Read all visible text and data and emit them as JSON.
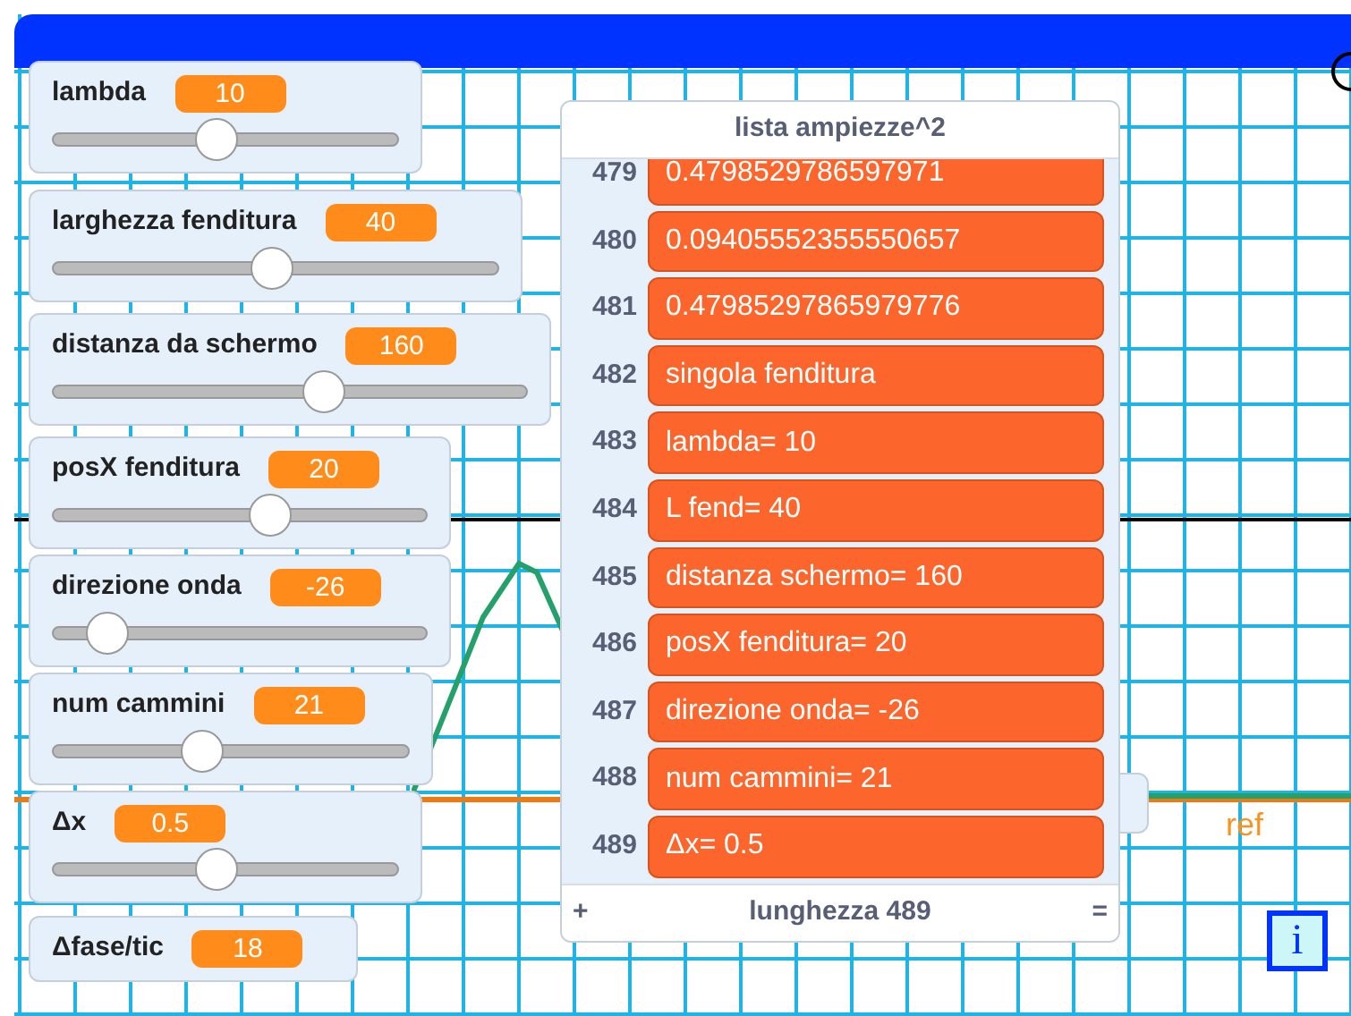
{
  "monitors": [
    {
      "label": "lambda",
      "value": "10",
      "level": 0.47,
      "kind": "slider"
    },
    {
      "label": "larghezza fenditura",
      "value": "40",
      "level": 0.49,
      "kind": "slider"
    },
    {
      "label": "distanza da schermo",
      "value": "160",
      "level": 0.58,
      "kind": "slider"
    },
    {
      "label": "posX fenditura",
      "value": "20",
      "level": 0.59,
      "kind": "slider"
    },
    {
      "label": "direzione onda",
      "value": "-26",
      "level": 0.1,
      "kind": "slider"
    },
    {
      "label": "num cammini",
      "value": "21",
      "level": 0.41,
      "kind": "slider"
    },
    {
      "label": "Δx",
      "value": "0.5",
      "level": 0.47,
      "kind": "slider"
    },
    {
      "label": "Δfase/tic",
      "value": "18",
      "kind": "readout"
    }
  ],
  "list": {
    "title": "lista ampiezze^2",
    "items": [
      {
        "index": "479",
        "value": "0.4798529786597971"
      },
      {
        "index": "480",
        "value": "0.09405552355550657"
      },
      {
        "index": "481",
        "value": "0.47985297865979776"
      },
      {
        "index": "482",
        "value": "singola fenditura"
      },
      {
        "index": "483",
        "value": "lambda= 10"
      },
      {
        "index": "484",
        "value": "L fend= 40"
      },
      {
        "index": "485",
        "value": "distanza schermo= 160"
      },
      {
        "index": "486",
        "value": "posX fenditura= 20"
      },
      {
        "index": "487",
        "value": "direzione onda= -26"
      },
      {
        "index": "488",
        "value": "num cammini= 21"
      },
      {
        "index": "489",
        "value": "Δx= 0.5"
      }
    ],
    "add": "+",
    "length": "lunghezza 489",
    "resize": "="
  },
  "stage_labels": {
    "ref": "ref",
    "info": "i"
  }
}
